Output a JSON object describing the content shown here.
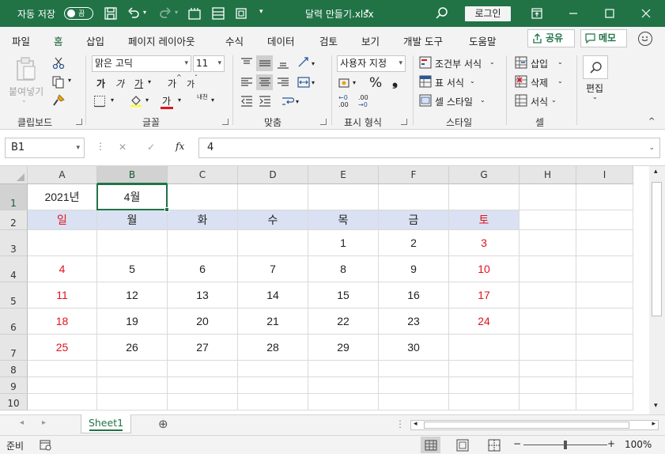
{
  "titlebar": {
    "autosave_label": "자동 저장",
    "autosave_state": "끔",
    "filename": "달력 만들기.xlsx",
    "filename_caret": "▾",
    "login_label": "로그인",
    "icons": [
      "save-icon",
      "undo-icon",
      "redo-icon",
      "new-window-icon",
      "form-icon",
      "customize-qat-icon",
      "search-icon",
      "ribbon-display-icon",
      "minimize-icon",
      "maximize-icon",
      "close-icon"
    ]
  },
  "menu": {
    "tabs": [
      "파일",
      "홈",
      "삽입",
      "페이지 레이아웃",
      "수식",
      "데이터",
      "검토",
      "보기",
      "개발 도구",
      "도움말"
    ],
    "active": "홈",
    "share_label": "공유",
    "memo_label": "메모"
  },
  "ribbon": {
    "clipboard": {
      "label": "클립보드",
      "paste_label": "붙여넣기"
    },
    "font": {
      "label": "글꼴",
      "font_name": "맑은 고딕",
      "font_size": "11",
      "bold": "가",
      "italic": "가",
      "underline": "가",
      "grow": "가",
      "shrink": "가",
      "font_color": "가",
      "phonetic": "내천"
    },
    "alignment": {
      "label": "맞춤"
    },
    "number": {
      "label": "표시 형식",
      "format": "사용자 지정",
      "percent": "%",
      "comma": "❟",
      "inc_decimal": ".00",
      "dec_decimal": ".00"
    },
    "styles": {
      "label": "스타일",
      "conditional": "조건부 서식",
      "table": "표 서식",
      "cell": "셀 스타일"
    },
    "cells": {
      "label": "셀",
      "insert": "삽입",
      "delete": "삭제",
      "format": "서식"
    },
    "editing": {
      "label": "편집"
    }
  },
  "formula_bar": {
    "name_box": "B1",
    "cancel_icon": "✕",
    "enter_icon": "✓",
    "fx_label": "fx",
    "value": "4"
  },
  "grid": {
    "columns": [
      "A",
      "B",
      "C",
      "D",
      "E",
      "F",
      "G",
      "H",
      "I"
    ],
    "selected_column": "B",
    "rows": [
      "1",
      "2",
      "3",
      "4",
      "5",
      "6",
      "7",
      "8",
      "9",
      "10"
    ],
    "year": "2021년",
    "month": "4월",
    "weekdays": [
      "일",
      "월",
      "화",
      "수",
      "목",
      "금",
      "토"
    ],
    "weeks": [
      [
        "",
        "",
        "",
        "",
        "1",
        "2",
        "3"
      ],
      [
        "4",
        "5",
        "6",
        "7",
        "8",
        "9",
        "10"
      ],
      [
        "11",
        "12",
        "13",
        "14",
        "15",
        "16",
        "17"
      ],
      [
        "18",
        "19",
        "20",
        "21",
        "22",
        "23",
        "24"
      ],
      [
        "25",
        "26",
        "27",
        "28",
        "29",
        "30",
        ""
      ]
    ],
    "weekend_color": "#e0141e",
    "header_fill": "#d9e1f2"
  },
  "sheets": {
    "tabs": [
      "Sheet1"
    ],
    "active": "Sheet1",
    "add_icon": "⊕"
  },
  "status": {
    "mode": "준비",
    "zoom_minus": "−",
    "zoom_plus": "+",
    "zoom": "100%",
    "zoom_fraction": 0.5
  },
  "colors": {
    "accent": "#217346",
    "title_bg": "#217346",
    "ribbon_bg": "#f3f3f3"
  }
}
